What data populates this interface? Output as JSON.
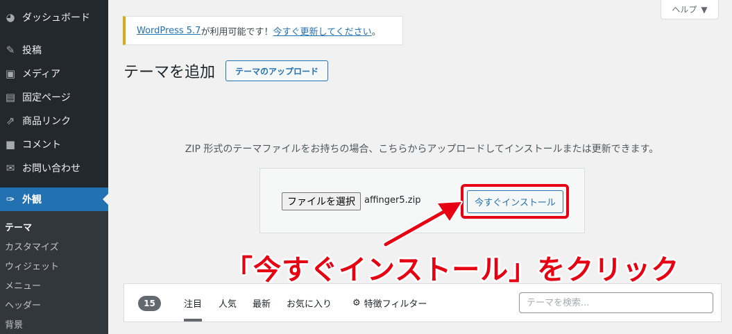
{
  "sidebar": {
    "items": [
      {
        "label": "ダッシュボード",
        "icon": "dashboard-icon"
      },
      {
        "label": "投稿",
        "icon": "pin-icon"
      },
      {
        "label": "メディア",
        "icon": "media-icon"
      },
      {
        "label": "固定ページ",
        "icon": "page-icon"
      },
      {
        "label": "商品リンク",
        "icon": "external-link-icon"
      },
      {
        "label": "コメント",
        "icon": "comment-icon"
      },
      {
        "label": "お問い合わせ",
        "icon": "mail-icon"
      },
      {
        "label": "外観",
        "icon": "brush-icon"
      }
    ],
    "submenu": [
      "テーマ",
      "カスタマイズ",
      "ウィジェット",
      "メニュー",
      "ヘッダー",
      "背景"
    ]
  },
  "help_tab": {
    "label": "ヘルプ"
  },
  "notice": {
    "link1": "WordPress 5.7",
    "middle": " が利用可能です！",
    "link2": "今すぐ更新してください",
    "end": "。"
  },
  "page": {
    "title": "テーマを追加",
    "upload_button": "テーマのアップロード"
  },
  "upload": {
    "description": "ZIP 形式のテーマファイルをお持ちの場合、こちらからアップロードしてインストールまたは更新できます。",
    "file_button": "ファイルを選択",
    "file_name": "affinger5.zip",
    "install_button": "今すぐインストール"
  },
  "annotation": {
    "text": "「今すぐインストール」をクリック",
    "color": "#e50012"
  },
  "filter": {
    "count": "15",
    "tabs": [
      "注目",
      "人気",
      "最新",
      "お気に入り"
    ],
    "feature_filter": "特徴フィルター",
    "search_placeholder": "テーマを検索..."
  },
  "colors": {
    "sidebar_bg": "#23282d",
    "accent": "#2271b1",
    "notice_border": "#dba617"
  }
}
